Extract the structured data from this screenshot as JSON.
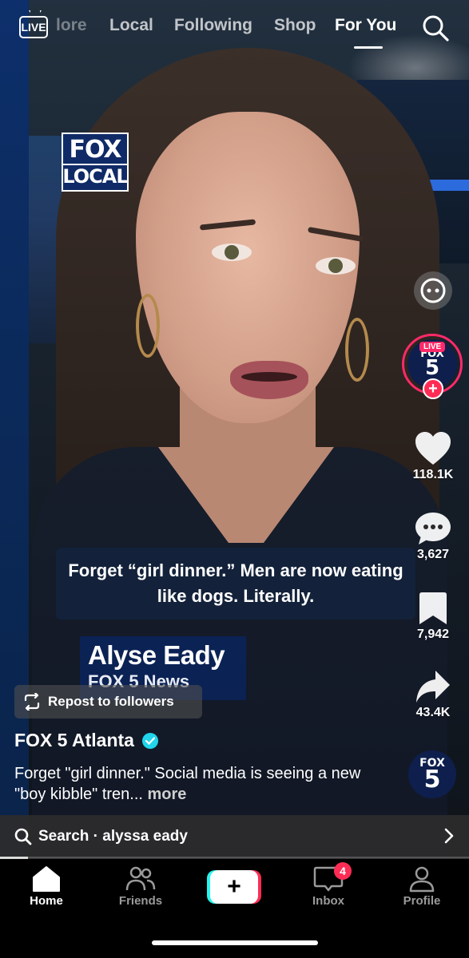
{
  "top_nav": {
    "live_label": "LIVE",
    "tabs": [
      {
        "label": "lore"
      },
      {
        "label": "Local"
      },
      {
        "label": "Following"
      },
      {
        "label": "Shop"
      },
      {
        "label": "For You"
      }
    ]
  },
  "video": {
    "logo_line1": "FOX",
    "logo_line2": "LOCAL",
    "caption": "Forget “girl dinner.” Men are now eating like dogs. Literally.",
    "lower_third_name": "Alyse Eady",
    "lower_third_org": "FOX 5 News"
  },
  "right_rail": {
    "avatar_live_badge": "LIVE",
    "avatar_line1": "FOX",
    "avatar_line2": "5",
    "likes": "118.1K",
    "comments": "3,627",
    "saves": "7,942",
    "shares": "43.4K",
    "sound_line1": "FOX",
    "sound_line2": "5"
  },
  "post": {
    "repost_label": "Repost to followers",
    "creator": "FOX 5 Atlanta",
    "description": "Forget \"girl dinner.\" Social media is seeing a new \"boy kibble\" tren...",
    "more_label": "more",
    "search_text": "Search · alyssa eady",
    "progress": 0.06
  },
  "bottom_nav": {
    "home": "Home",
    "friends": "Friends",
    "inbox": "Inbox",
    "inbox_badge": "4",
    "profile": "Profile"
  },
  "colors": {
    "accent_pink": "#fe2c55",
    "accent_cyan": "#25f4ee",
    "verified": "#20d5ec"
  }
}
